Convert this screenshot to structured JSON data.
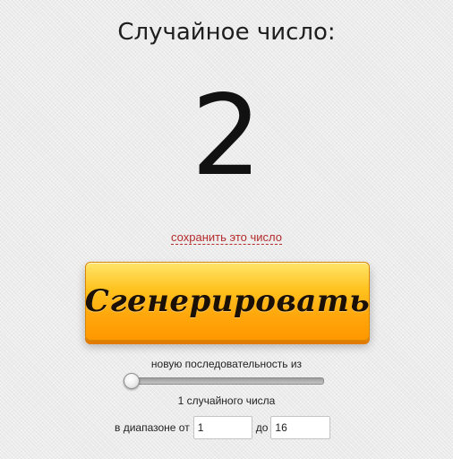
{
  "header": {
    "title": "Случайное число:"
  },
  "result": {
    "number": "2"
  },
  "actions": {
    "save_link": "сохранить это число",
    "generate_label": "Сгенерировать"
  },
  "sequence": {
    "label": "новую последовательность из",
    "slider_value": 1,
    "count_text": "1 случайного числа"
  },
  "range": {
    "from_label": "в диапазоне от",
    "from_value": "1",
    "to_label": "до",
    "to_value": "16"
  },
  "colors": {
    "button_top": "#ffe56b",
    "button_bottom": "#ff9800",
    "link": "#b42a2a",
    "background": "#efefef"
  }
}
